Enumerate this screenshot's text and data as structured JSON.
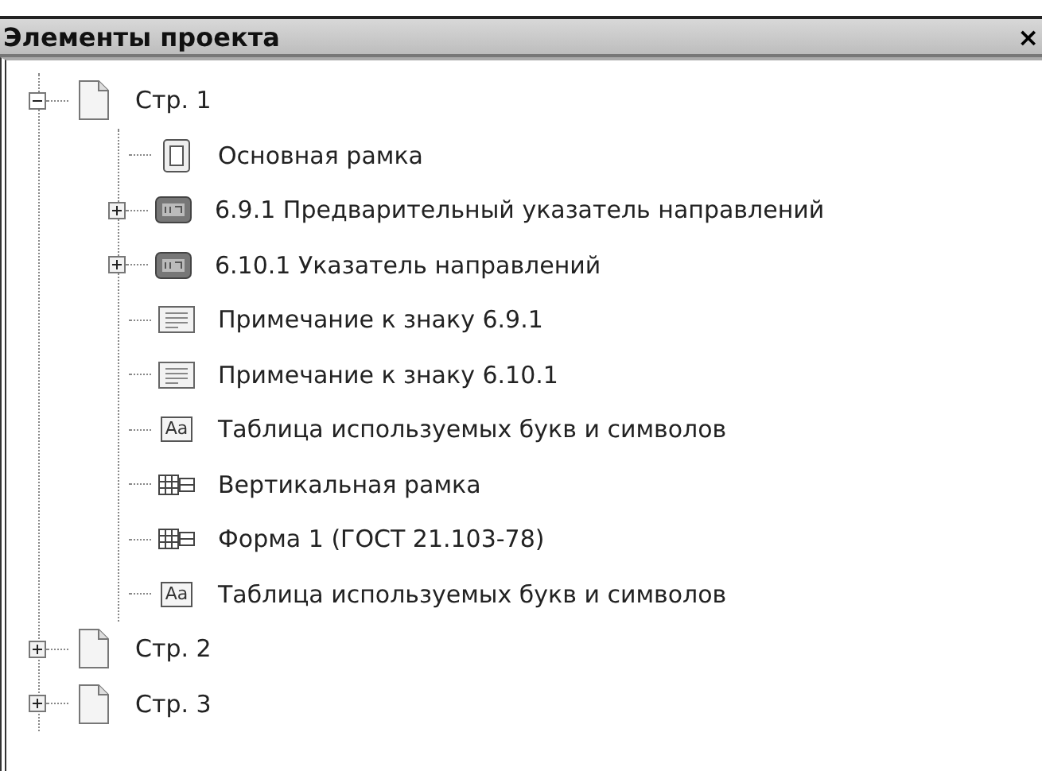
{
  "panel": {
    "title": "Элементы проекта",
    "close": "×"
  },
  "tree": [
    {
      "label": "Стр. 1",
      "kind": "page",
      "expandable": true,
      "expanded": true,
      "children": [
        {
          "label": "Основная рамка",
          "kind": "frame",
          "expandable": false,
          "expanded": false
        },
        {
          "label": "6.9.1 Предварительный указатель направлений",
          "kind": "sign",
          "expandable": true,
          "expanded": false
        },
        {
          "label": "6.10.1 Указатель направлений",
          "kind": "sign",
          "expandable": true,
          "expanded": false
        },
        {
          "label": "Примечание к знаку 6.9.1",
          "kind": "note",
          "expandable": false,
          "expanded": false
        },
        {
          "label": "Примечание к знаку 6.10.1",
          "kind": "note",
          "expandable": false,
          "expanded": false
        },
        {
          "label": "Таблица используемых букв и символов",
          "kind": "letters",
          "icon_text": "Aa",
          "expandable": false,
          "expanded": false
        },
        {
          "label": "Вертикальная рамка",
          "kind": "form",
          "expandable": false,
          "expanded": false
        },
        {
          "label": "Форма 1 (ГОСТ 21.103-78)",
          "kind": "form",
          "expandable": false,
          "expanded": false
        },
        {
          "label": "Таблица используемых букв и символов",
          "kind": "letters",
          "icon_text": "Aa",
          "expandable": false,
          "expanded": false
        }
      ]
    },
    {
      "label": "Стр. 2",
      "kind": "page",
      "expandable": true,
      "expanded": false
    },
    {
      "label": "Стр. 3",
      "kind": "page",
      "expandable": true,
      "expanded": false
    }
  ]
}
